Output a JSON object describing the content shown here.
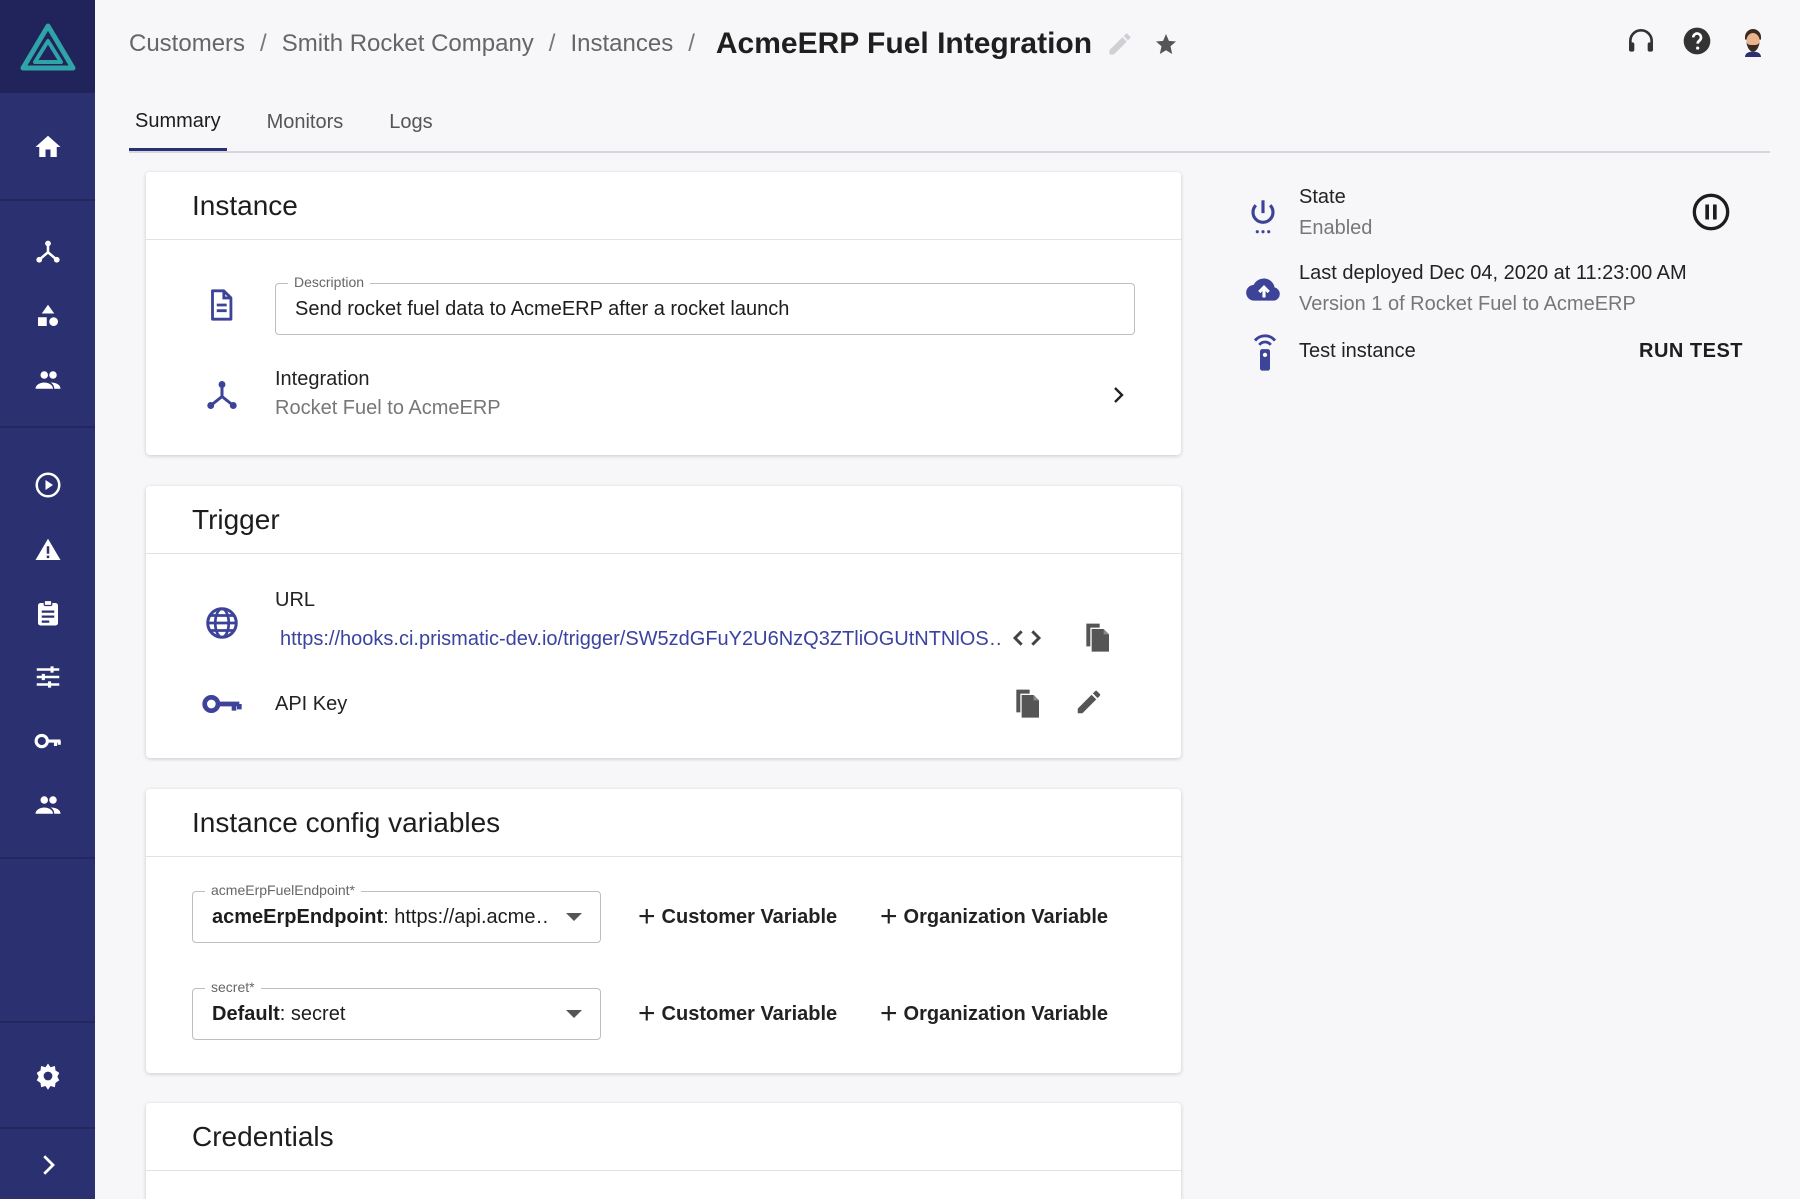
{
  "breadcrumb": {
    "items": [
      "Customers",
      "Smith Rocket Company",
      "Instances"
    ],
    "current": "AcmeERP Fuel Integration"
  },
  "tabs": [
    "Summary",
    "Monitors",
    "Logs"
  ],
  "instance_card": {
    "title": "Instance",
    "description_legend": "Description",
    "description_value": "Send rocket fuel data to AcmeERP after a rocket launch",
    "integration_label": "Integration",
    "integration_value": "Rocket Fuel to AcmeERP"
  },
  "trigger_card": {
    "title": "Trigger",
    "url_label": "URL",
    "url_value": "https://hooks.ci.prismatic-dev.io/trigger/SW5zdGFuY2U6NzQ3ZTliOGUtNTNlOS…",
    "api_key_label": "API Key"
  },
  "config_card": {
    "title": "Instance config variables",
    "variables": [
      {
        "legend": "acmeErpFuelEndpoint*",
        "key": "acmeErpEndpoint",
        "value": ": https://api.acme…",
        "customer_btn": "Customer Variable",
        "org_btn": "Organization Variable"
      },
      {
        "legend": "secret*",
        "key": "Default",
        "value": ": secret",
        "customer_btn": "Customer Variable",
        "org_btn": "Organization Variable"
      }
    ]
  },
  "credentials_card": {
    "title": "Credentials"
  },
  "right_panel": {
    "state_label": "State",
    "state_value": "Enabled",
    "deployed_label": "Last deployed Dec 04, 2020 at 11:23:00 AM",
    "deployed_value": "Version 1 of Rocket Fuel to AcmeERP",
    "test_label": "Test instance",
    "run_test": "RUN TEST"
  },
  "colors": {
    "sidebar": "#2b3070",
    "sidebar_dark": "#20245a",
    "accent": "#3d4398",
    "link": "#3b43a0",
    "logo": "#2fa3a8"
  },
  "icons": {
    "sidebar": [
      "logo-icon",
      "home-icon",
      "integrations-icon",
      "components-icon",
      "customers-icon",
      "executions-icon",
      "alerts-icon",
      "logs-icon",
      "settings-sliders-icon",
      "key-icon",
      "users-icon",
      "gear-icon",
      "chevron-right-icon"
    ],
    "topbar": [
      "headset-icon",
      "help-icon",
      "avatar-icon"
    ]
  }
}
